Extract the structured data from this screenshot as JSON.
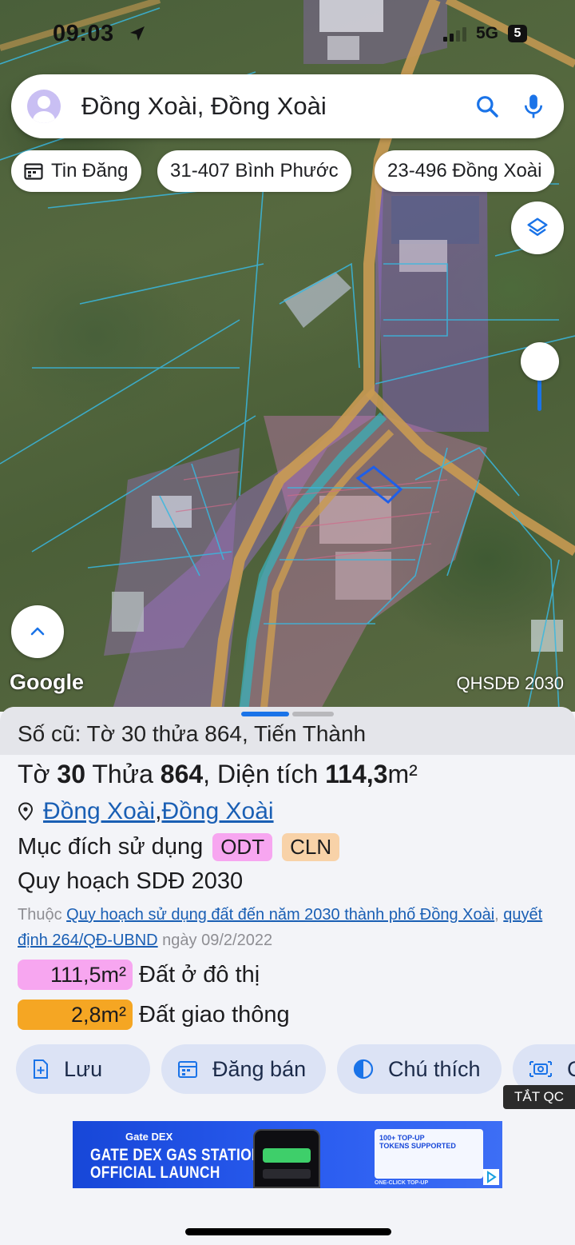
{
  "status_bar": {
    "time": "09:03",
    "network": "5G",
    "battery": "5"
  },
  "search": {
    "query": "Đồng Xoài, Đồng Xoài"
  },
  "chips": [
    {
      "label": "Tin Đăng"
    },
    {
      "label": "31-407 Bình Phước"
    },
    {
      "label": "23-496 Đồng Xoài"
    }
  ],
  "map": {
    "attribution": "Google",
    "layer_label": "QHSDĐ 2030"
  },
  "sheet": {
    "old_info": "Số cũ: Tờ 30 thửa 864, Tiến Thành",
    "title_to": "Tờ ",
    "title_to_num": "30",
    "title_thua": " Thửa ",
    "title_thua_num": "864",
    "title_area_label": ", Diện tích ",
    "title_area": "114,3",
    "title_unit": "m²",
    "location_ward": "Đồng Xoài",
    "location_sep": ", ",
    "location_city": "Đồng Xoài",
    "purpose_label": "Mục đích sử dụng",
    "purpose_tags": [
      {
        "code": "ODT",
        "color": "#f7a6f0"
      },
      {
        "code": "CLN",
        "color": "#f8d2a8"
      }
    ],
    "plan_title": "Quy hoạch SDĐ 2030",
    "plan_prefix": "Thuộc ",
    "plan_link": "Quy hoạch sử dụng đất đến năm 2030 thành phố Đồng Xoài",
    "plan_sep": ", ",
    "plan_decision": "quyết định 264/QĐ-UBND",
    "plan_date": " ngày 09/2/2022",
    "areas": [
      {
        "value": "111,5m²",
        "label": "Đất ở đô thị",
        "color": "#f7a6f0"
      },
      {
        "value": "2,8m²",
        "label": "Đất giao thông",
        "color": "#f5a623"
      }
    ],
    "actions": [
      {
        "label": "Lưu",
        "icon": "add-file-icon"
      },
      {
        "label": "Đăng bán",
        "icon": "calendar-icon"
      },
      {
        "label": "Chú thích",
        "icon": "contrast-icon"
      },
      {
        "label": "C",
        "icon": "camera-icon"
      }
    ],
    "ad_close_label": "TẮT QC"
  },
  "ad": {
    "brand": "Gate DEX",
    "headline_line1": "GATE DEX GAS STATION",
    "headline_line2": "OFFICIAL LAUNCH",
    "card_title_line1": "100+ TOP-UP",
    "card_title_line2": "TOKENS SUPPORTED",
    "footer": "ONE-CLICK TOP-UP"
  },
  "colors": {
    "accent": "#1a73e8",
    "link": "#1a5fb4",
    "action_bg": "#dce3f5"
  }
}
